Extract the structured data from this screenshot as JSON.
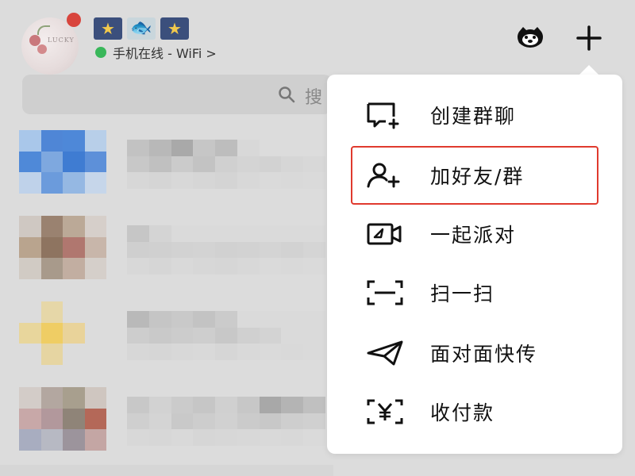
{
  "header": {
    "online_status": "手机在线 - WiFi >",
    "status_icons": [
      "star-icon",
      "fish-icon",
      "star-icon"
    ],
    "right_icons": [
      "tiger-icon",
      "plus-icon"
    ]
  },
  "search": {
    "placeholder": "搜"
  },
  "menu": {
    "items": [
      {
        "label": "创建群聊",
        "icon": "chat-plus-icon"
      },
      {
        "label": "加好友/群",
        "icon": "add-friend-icon"
      },
      {
        "label": "一起派对",
        "icon": "party-video-icon"
      },
      {
        "label": "扫一扫",
        "icon": "scan-icon"
      },
      {
        "label": "面对面快传",
        "icon": "paper-plane-icon"
      },
      {
        "label": "收付款",
        "icon": "yuan-scan-icon"
      }
    ],
    "highlighted_index": 1,
    "highlight_color": "#e03a2e"
  },
  "colors": {
    "online": "#39b75a",
    "badge": "#d8453d",
    "background": "#dcdcdc"
  }
}
